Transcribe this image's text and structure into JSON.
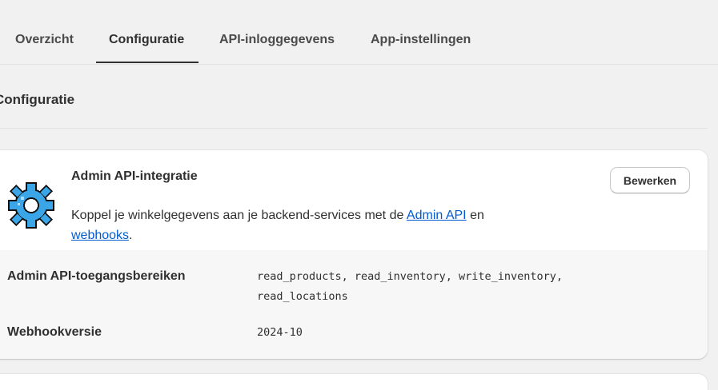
{
  "tabs": [
    {
      "label": "Overzicht",
      "active": false
    },
    {
      "label": "Configuratie",
      "active": true
    },
    {
      "label": "API-inloggegevens",
      "active": false
    },
    {
      "label": "App-instellingen",
      "active": false
    }
  ],
  "section": {
    "title": "Configuratie"
  },
  "card": {
    "icon": "gear-icon",
    "title": "Admin API-integratie",
    "edit_label": "Bewerken",
    "description": {
      "prefix": "Koppel je winkelgegevens aan je backend-services met de ",
      "link1": "Admin API",
      "middle": " en ",
      "link2": "webhooks",
      "suffix": "."
    },
    "rows": [
      {
        "label": "Admin API-toegangsbereiken",
        "value": "read_products, read_inventory, write_inventory, read_locations"
      },
      {
        "label": "Webhookversie",
        "value": "2024-10"
      }
    ]
  },
  "colors": {
    "background": "#f1f1f1",
    "link": "#005bd3",
    "icon_fill": "#3aa6e8",
    "text": "#303030"
  }
}
